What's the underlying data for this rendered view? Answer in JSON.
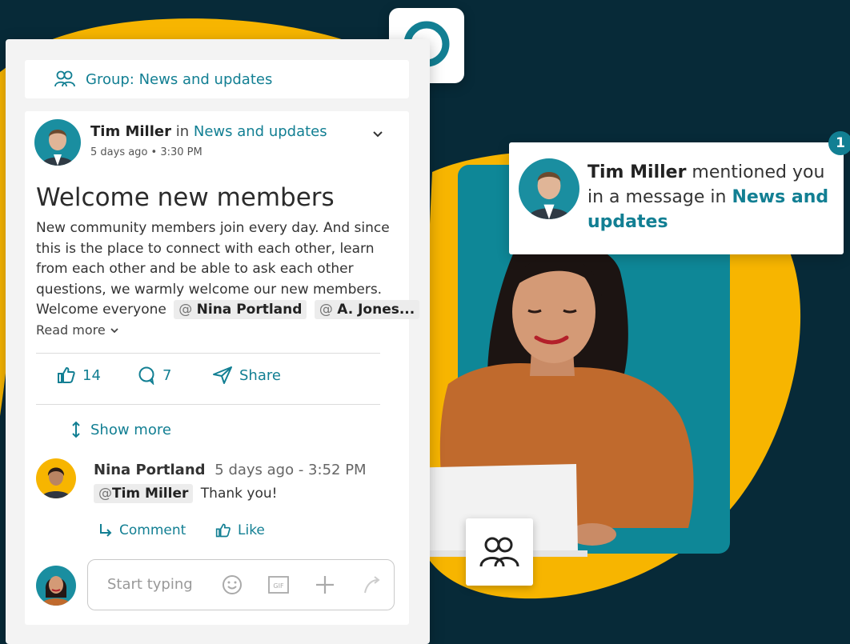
{
  "group_bar": {
    "label": "Group: News and updates"
  },
  "post": {
    "author": "Tim Miller",
    "in_word": "in",
    "group": "News and updates",
    "meta": "5 days ago • 3:30 PM",
    "title": "Welcome new members",
    "body_lines": [
      "New community members join every day. And since",
      "this is the place to connect with each other, learn",
      "from each other and be able to ask each other",
      "questions, we warmly welcome our new members."
    ],
    "last_line_text": "Welcome everyone",
    "mentions": [
      {
        "at": "@",
        "name": "Nina Portland"
      },
      {
        "at": "@",
        "name": "A. Jones..."
      }
    ],
    "read_more": "Read more",
    "likes": "14",
    "comments": "7",
    "share_label": "Share",
    "show_more_label": "Show more"
  },
  "comment": {
    "author": "Nina Portland",
    "timestamp": "5 days ago - 3:52 PM",
    "mention_at": "@",
    "mention_name": "Tim Miller",
    "text": "Thank you!",
    "comment_label": "Comment",
    "like_label": "Like"
  },
  "composer": {
    "placeholder": "Start typing",
    "tools": [
      "smiley-icon",
      "gif-icon",
      "plus-icon",
      "send-icon"
    ]
  },
  "notification": {
    "author": "Tim Miller",
    "line1_rest": "mentioned you",
    "line2_text": "in a message in",
    "line2_link": "News and",
    "line3_link": "updates",
    "badge_count": "1"
  },
  "colors": {
    "background": "#072a38",
    "accent_teal": "#127f93",
    "yellow": "#f7b500",
    "panel_teal": "#0e8797"
  }
}
